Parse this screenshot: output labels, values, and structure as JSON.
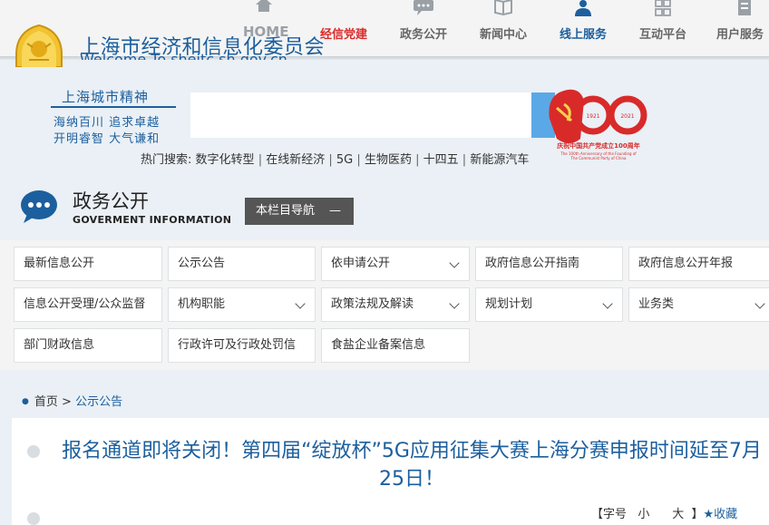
{
  "header": {
    "title": "上海市经济和信息化委员会",
    "subtitle": "Welcome To sheitc.sh.gov.cn",
    "home": "HOME",
    "nav": [
      {
        "label": "经信党建",
        "icon": "flag-icon"
      },
      {
        "label": "政务公开",
        "icon": "chat-icon"
      },
      {
        "label": "新闻中心",
        "icon": "news-icon"
      },
      {
        "label": "线上服务",
        "icon": "user-service-icon"
      },
      {
        "label": "互动平台",
        "icon": "grid-icon"
      },
      {
        "label": "用户服务",
        "icon": "document-icon"
      }
    ]
  },
  "spirit": {
    "title": "上海城市精神",
    "line1": "海纳百川 追求卓越",
    "line2": "开明睿智 大气谦和"
  },
  "search": {
    "placeholder": ""
  },
  "hot": {
    "label": "热门搜索:",
    "terms": [
      "数字化转型",
      "在线新经济",
      "5G",
      "生物医药",
      "十四五",
      "新能源汽车"
    ]
  },
  "badge": {
    "years": "1921 — 2021",
    "caption": "庆祝中国共产党成立100周年",
    "caption_en": "The 100th Anniversary of the Founding of The Communist Party of China"
  },
  "section": {
    "title": "政务公开",
    "en": "GOVERMENT INFORMATION",
    "nav_label": "本栏目导航",
    "nav_toggle": "—"
  },
  "categories": [
    {
      "label": "最新信息公开",
      "dropdown": false
    },
    {
      "label": "公示公告",
      "dropdown": false
    },
    {
      "label": "依申请公开",
      "dropdown": true
    },
    {
      "label": "政府信息公开指南",
      "dropdown": false
    },
    {
      "label": "政府信息公开年报",
      "dropdown": false
    },
    {
      "label": "信息公开受理/公众监督",
      "dropdown": false
    },
    {
      "label": "机构职能",
      "dropdown": true
    },
    {
      "label": "政策法规及解读",
      "dropdown": true
    },
    {
      "label": "规划计划",
      "dropdown": true
    },
    {
      "label": "业务类",
      "dropdown": true
    },
    {
      "label": "部门财政信息",
      "dropdown": false
    },
    {
      "label": "行政许可及行政处罚信",
      "dropdown": false
    },
    {
      "label": "食盐企业备案信息",
      "dropdown": false
    }
  ],
  "breadcrumb": {
    "home": "首页",
    "sep": ">",
    "current": "公示公告"
  },
  "article": {
    "title": "报名通道即将关闭！第四届“绽放杯”5G应用征集大赛上海分赛申报时间延至7月25日！",
    "font_label": "【字号",
    "small": "小",
    "large": "大",
    "close": "】",
    "favorite": "★收藏"
  },
  "colors": {
    "brand_blue": "#1c5f9e",
    "party_red": "#d92a2a",
    "nav_dark": "#555555"
  }
}
